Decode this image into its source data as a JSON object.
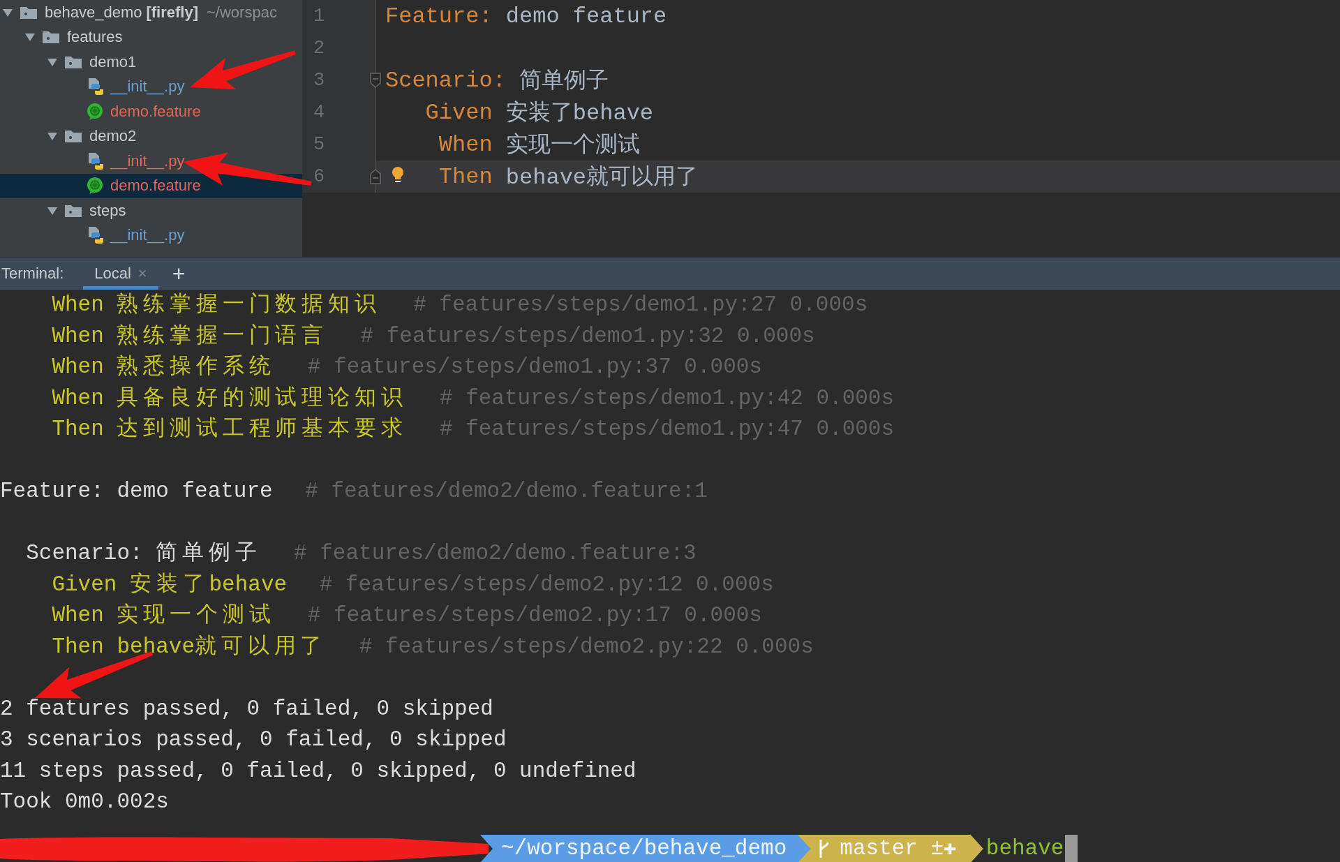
{
  "project_tree": {
    "items": [
      {
        "kind": "folder",
        "name": "behave_demo",
        "tag": "[firefly]",
        "path": "~/worspac",
        "expanded": true,
        "selected": false,
        "children": [
          {
            "kind": "folder",
            "name": "features",
            "expanded": true,
            "selected": false,
            "children": [
              {
                "kind": "folder",
                "name": "demo1",
                "expanded": true,
                "selected": false,
                "children": [
                  {
                    "kind": "python",
                    "name": "__init__.py",
                    "color": "#6a9fd2",
                    "selected": false
                  },
                  {
                    "kind": "feature",
                    "name": "demo.feature",
                    "color": "#e0665a",
                    "selected": false
                  }
                ]
              },
              {
                "kind": "folder",
                "name": "demo2",
                "expanded": true,
                "selected": false,
                "children": [
                  {
                    "kind": "python",
                    "name": "__init__.py",
                    "color": "#e0665a",
                    "selected": false
                  },
                  {
                    "kind": "feature",
                    "name": "demo.feature",
                    "color": "#e0665a",
                    "selected": true
                  }
                ]
              },
              {
                "kind": "folder",
                "name": "steps",
                "expanded": true,
                "selected": false,
                "children": [
                  {
                    "kind": "python",
                    "name": "__init__.py",
                    "color": "#6a9fd2",
                    "selected": false
                  }
                ]
              }
            ]
          }
        ]
      }
    ]
  },
  "editor": {
    "lines": [
      {
        "number": "1",
        "kind": "feature",
        "keyword": "Feature:",
        "text": "demo feature",
        "fold_start": false,
        "fold_end": false,
        "hint": false,
        "current": false
      },
      {
        "number": "2",
        "kind": "blank",
        "fold_start": false,
        "fold_end": false,
        "hint": false,
        "current": false
      },
      {
        "number": "3",
        "kind": "scenario",
        "keyword": "Scenario:",
        "text": "简单例子",
        "fold_start": true,
        "fold_end": false,
        "hint": false,
        "current": false
      },
      {
        "number": "4",
        "kind": "step",
        "keyword": "Given",
        "text": "安装了behave",
        "fold_start": false,
        "fold_end": false,
        "hint": false,
        "current": false
      },
      {
        "number": "5",
        "kind": "step",
        "keyword": "When",
        "text": "实现一个测试",
        "fold_start": false,
        "fold_end": false,
        "hint": false,
        "current": false
      },
      {
        "number": "6",
        "kind": "step",
        "keyword": "Then",
        "text": "behave就可以用了",
        "fold_start": false,
        "fold_end": true,
        "hint": true,
        "current": true
      }
    ]
  },
  "terminal": {
    "label": "Terminal:",
    "tabs": [
      {
        "label": "Local",
        "close": "×",
        "selected": true
      }
    ],
    "add": "+",
    "blocks": [
      {
        "lines": [
          {
            "kind": "step",
            "text": "When 熟练掌握一门数据知识",
            "comment": "# features/steps/demo1.py:27 0.000s"
          },
          {
            "kind": "step",
            "text": "When 熟练掌握一门语言",
            "comment": "# features/steps/demo1.py:32 0.000s"
          },
          {
            "kind": "step",
            "text": "When 熟悉操作系统",
            "comment": "# features/steps/demo1.py:37 0.000s"
          },
          {
            "kind": "step",
            "text": "When 具备良好的测试理论知识",
            "comment": "# features/steps/demo1.py:42 0.000s"
          },
          {
            "kind": "step",
            "text": "Then 达到测试工程师基本要求",
            "comment": "# features/steps/demo1.py:47 0.000s"
          }
        ]
      },
      {
        "lines": [
          {
            "kind": "feature",
            "text": "Feature: demo feature",
            "comment": "# features/demo2/demo.feature:1"
          }
        ]
      },
      {
        "lines": [
          {
            "kind": "scenario",
            "text": "Scenario: 简单例子",
            "comment": "# features/demo2/demo.feature:3"
          },
          {
            "kind": "step",
            "text": "Given 安装了behave",
            "comment": "# features/steps/demo2.py:12 0.000s"
          },
          {
            "kind": "step",
            "text": "When 实现一个测试",
            "comment": "# features/steps/demo2.py:17 0.000s"
          },
          {
            "kind": "step",
            "text": "Then behave就可以用了",
            "comment": "# features/steps/demo2.py:22 0.000s"
          }
        ]
      },
      {
        "lines": [
          {
            "kind": "summary",
            "text": "2 features passed, 0 failed, 0 skipped"
          },
          {
            "kind": "summary",
            "text": "3 scenarios passed, 0 failed, 0 skipped"
          },
          {
            "kind": "summary",
            "text": "11 steps passed, 0 failed, 0 skipped, 0 undefined"
          },
          {
            "kind": "summary",
            "text": "Took 0m0.002s"
          }
        ]
      }
    ],
    "prompt": [
      {
        "kind": "redacted"
      },
      {
        "kind": "path",
        "text": "~/worspace/behave_demo"
      },
      {
        "kind": "git",
        "text": "master ±✚"
      },
      {
        "kind": "command",
        "text": "behave"
      }
    ]
  },
  "annotation_arrows": [
    {
      "kind": "arrow"
    },
    {
      "kind": "arrow"
    },
    {
      "kind": "arrow"
    }
  ]
}
